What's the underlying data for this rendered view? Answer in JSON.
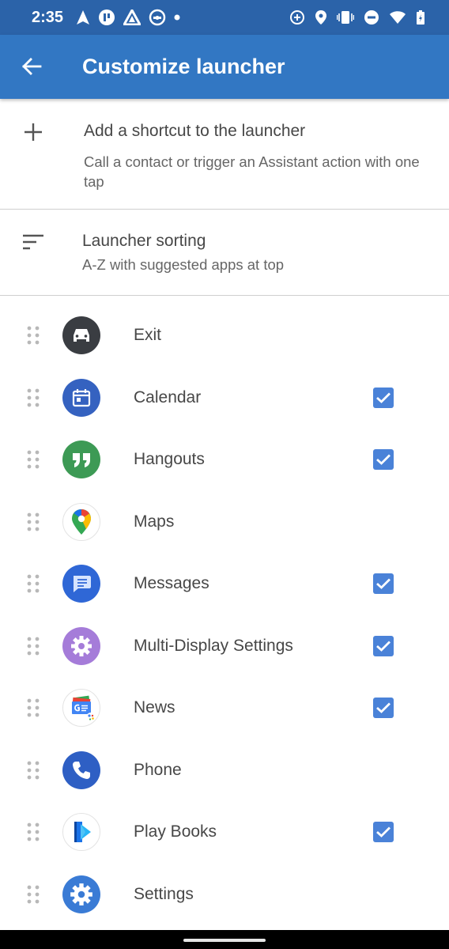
{
  "status_bar": {
    "time": "2:35",
    "left_icons": [
      "navigation-icon",
      "notification-icon",
      "assistant-icon",
      "android-auto-icon",
      "dot-icon"
    ],
    "right_icons": [
      "data-saver-icon",
      "location-icon",
      "vibrate-icon",
      "do-not-disturb-icon",
      "wifi-icon",
      "battery-icon"
    ],
    "background": "#2b63a9"
  },
  "app_bar": {
    "title": "Customize launcher",
    "back_icon": "arrow-back-icon",
    "background": "#3277c3"
  },
  "shortcut_row": {
    "icon": "plus-icon",
    "title": "Add a shortcut to the launcher",
    "subtitle": "Call a contact or trigger an Assistant action with one tap"
  },
  "sorting_row": {
    "icon": "sort-icon",
    "title": "Launcher sorting",
    "subtitle": "A-Z with suggested apps at top"
  },
  "apps": [
    {
      "name": "Exit",
      "checked": false,
      "icon": "car-icon"
    },
    {
      "name": "Calendar",
      "checked": true,
      "icon": "calendar-icon"
    },
    {
      "name": "Hangouts",
      "checked": true,
      "icon": "hangouts-icon"
    },
    {
      "name": "Maps",
      "checked": false,
      "icon": "maps-pin-icon"
    },
    {
      "name": "Messages",
      "checked": true,
      "icon": "messages-icon"
    },
    {
      "name": "Multi-Display Settings",
      "checked": true,
      "icon": "gear-icon"
    },
    {
      "name": "News",
      "checked": true,
      "icon": "news-icon"
    },
    {
      "name": "Phone",
      "checked": false,
      "icon": "phone-icon"
    },
    {
      "name": "Play Books",
      "checked": true,
      "icon": "play-books-icon"
    },
    {
      "name": "Settings",
      "checked": false,
      "icon": "settings-gear-icon"
    }
  ],
  "colors": {
    "accent": "#4a82d8",
    "text_primary": "#474747",
    "text_secondary": "#666666"
  }
}
